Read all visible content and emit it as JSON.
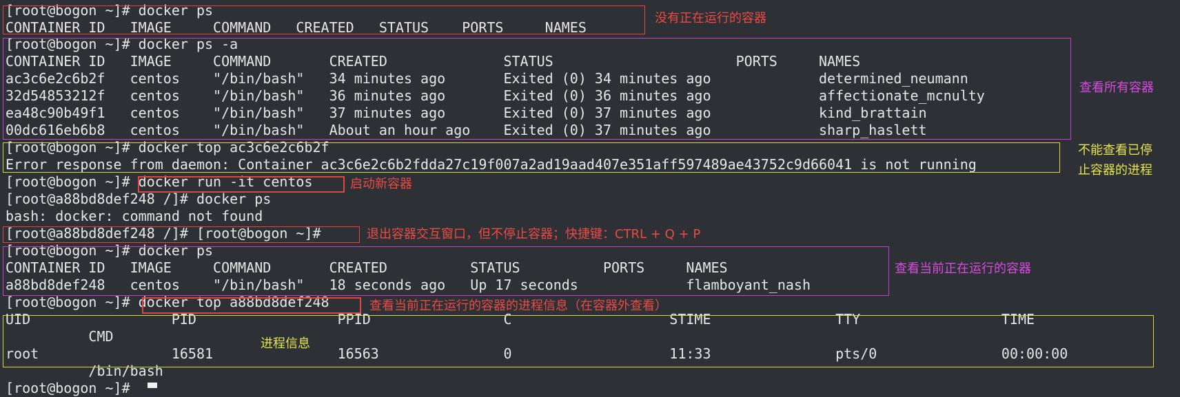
{
  "terminal": {
    "lines": [
      "[root@bogon ~]# docker ps",
      "CONTAINER ID   IMAGE     COMMAND   CREATED   STATUS    PORTS     NAMES",
      "[root@bogon ~]# docker ps -a",
      "CONTAINER ID   IMAGE     COMMAND       CREATED              STATUS                      PORTS     NAMES",
      "ac3c6e2c6b2f   centos    \"/bin/bash\"   34 minutes ago       Exited (0) 34 minutes ago             determined_neumann",
      "32d54853212f   centos    \"/bin/bash\"   36 minutes ago       Exited (0) 36 minutes ago             affectionate_mcnulty",
      "ea48c90b49f1   centos    \"/bin/bash\"   37 minutes ago       Exited (0) 37 minutes ago             kind_brattain",
      "00dc616eb6b8   centos    \"/bin/bash\"   About an hour ago    Exited (0) 37 minutes ago             sharp_haslett",
      "[root@bogon ~]# docker top ac3c6e2c6b2f",
      "Error response from daemon: Container ac3c6e2c6b2fdda27c19f007a2ad19aad407e351aff597489ae43752c9d66041 is not running",
      "[root@bogon ~]# docker run -it centos",
      "[root@a88bd8def248 /]# docker ps",
      "bash: docker: command not found",
      "[root@a88bd8def248 /]# [root@bogon ~]#",
      "[root@bogon ~]# docker ps",
      "CONTAINER ID   IMAGE     COMMAND       CREATED          STATUS          PORTS     NAMES",
      "a88bd8def248   centos    \"/bin/bash\"   18 seconds ago   Up 17 seconds             flamboyant_nash",
      "[root@bogon ~]# docker top a88bd8def248",
      "UID                 PID                 PPID                C                   STIME               TTY                 TIME",
      "          CMD",
      "root                16581               16563               0                   11:33               pts/0               00:00:00",
      "          /bin/bash",
      "[root@bogon ~]# "
    ]
  },
  "annotations": {
    "no_running": "没有正在运行的容器",
    "view_all": "查看所有容器",
    "cannot_view_line1": "不能查看已停",
    "cannot_view_line2": "止容器的进程",
    "start_new": "启动新容器",
    "exit_tip": "退出容器交互窗口，但不停止容器；快捷键：CTRL + Q + P",
    "view_running": "查看当前正在运行的容器",
    "view_process": "查看当前正在运行的容器的进程信息（在容器外查看）",
    "process_info": "进程信息"
  },
  "colors": {
    "background": "#2d3136",
    "text": "#e6e6e6",
    "red": "#e0463f",
    "magenta": "#c93fd3",
    "yellow": "#d8d64a"
  }
}
